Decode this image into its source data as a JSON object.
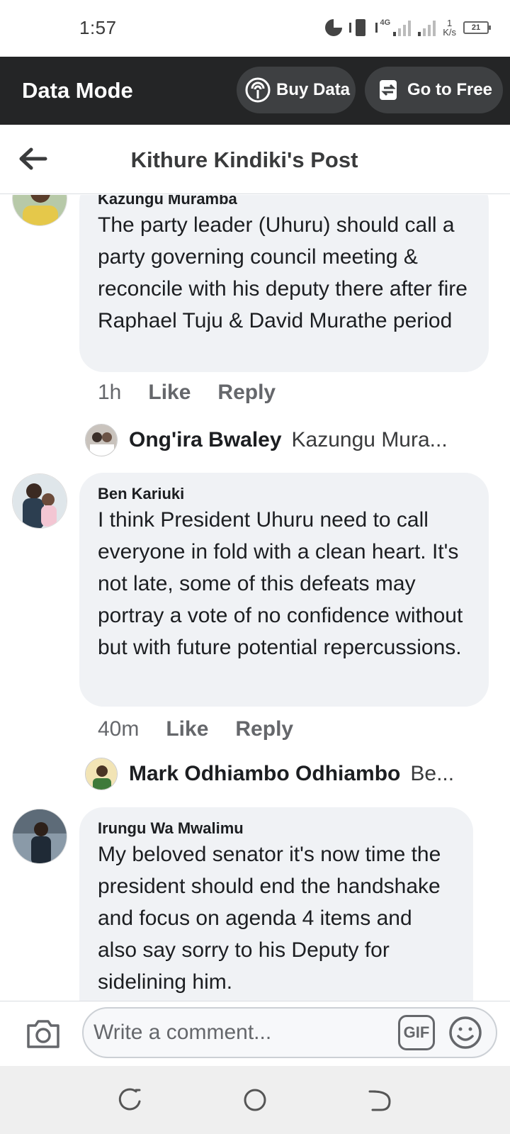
{
  "status_bar": {
    "time": "1:57",
    "network_type": "4G",
    "speed_value": "1",
    "speed_unit": "K/s",
    "battery": "21"
  },
  "data_mode_bar": {
    "title": "Data Mode",
    "buy_data_label": "Buy Data",
    "go_to_free_label": "Go to Free"
  },
  "header": {
    "title": "Kithure Kindiki's Post"
  },
  "comments": [
    {
      "author": "Kazungu Muramba",
      "text": "The party leader (Uhuru) should call a party governing council meeting & reconcile with his deputy there after fire Raphael Tuju & David Murathe period",
      "time": "1h",
      "like_label": "Like",
      "reply_label": "Reply",
      "reply_preview": {
        "name": "Ong'ira Bwaley",
        "snippet": "Kazungu Mura..."
      }
    },
    {
      "author": "Ben Kariuki",
      "text": "I think President Uhuru need to call everyone in fold with a clean heart. It's not late, some of this defeats may portray a vote of no confidence without but with future potential repercussions.",
      "time": "40m",
      "like_label": "Like",
      "reply_label": "Reply",
      "reply_preview": {
        "name": "Mark Odhiambo Odhiambo",
        "snippet": "Be..."
      }
    },
    {
      "author": "Irungu Wa Mwalimu",
      "text": "My beloved senator it's now time the president should end the handshake and focus on agenda 4 items and also say sorry to his Deputy for sidelining him."
    }
  ],
  "composer": {
    "placeholder": "Write a comment...",
    "gif_label": "GIF"
  },
  "colors": {
    "data_mode_bg": "#242526",
    "pill_bg": "#3e4042",
    "bubble_bg": "#f0f2f5",
    "secondary_text": "#65676b",
    "primary_text": "#1c1e21"
  },
  "icons": {
    "status": [
      "data-saver-icon",
      "vibrate-icon",
      "signal-icon",
      "battery-icon"
    ],
    "buy_data": "broadcast-icon",
    "go_to_free": "switch-free-icon",
    "back": "back-arrow-icon",
    "camera": "camera-icon",
    "emoji": "emoji-icon",
    "nav": [
      "recents-icon",
      "home-icon",
      "back-icon"
    ]
  }
}
